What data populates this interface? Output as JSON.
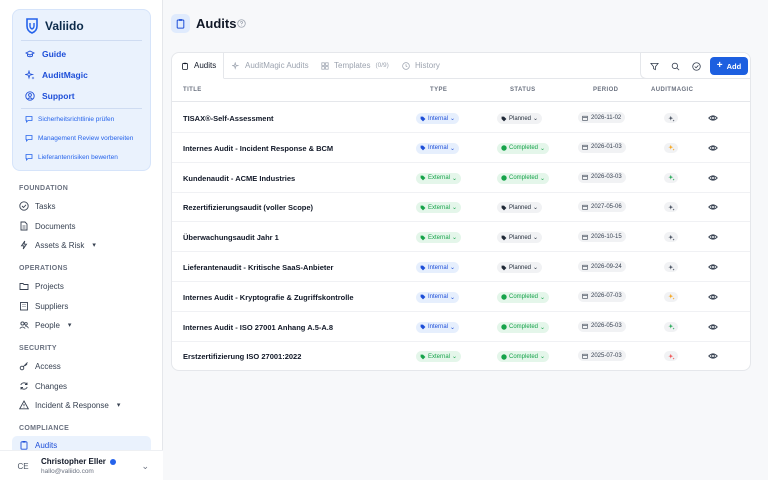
{
  "brand": {
    "name": "Valiido"
  },
  "brand_nav": [
    {
      "label": "Guide",
      "icon": "graduation-cap-icon"
    },
    {
      "label": "AuditMagic",
      "icon": "sparkles-icon"
    },
    {
      "label": "Support",
      "icon": "user-circle-icon"
    }
  ],
  "todos": [
    "Sicherheitsrichtlinie prüfen",
    "Management Review vorbereiten",
    "Lieferantenrisiken bewerten"
  ],
  "sections": {
    "foundation": "FOUNDATION",
    "operations": "OPERATIONS",
    "security": "SECURITY",
    "compliance": "COMPLIANCE"
  },
  "nav": {
    "tasks": "Tasks",
    "documents": "Documents",
    "assets": "Assets & Risk",
    "projects": "Projects",
    "suppliers": "Suppliers",
    "people": "People",
    "access": "Access",
    "changes": "Changes",
    "incident": "Incident & Response",
    "audits": "Audits"
  },
  "user": {
    "initials": "CE",
    "name": "Christopher Eller",
    "email": "hallo@valiido.com"
  },
  "header": {
    "title": "Audits"
  },
  "tabs": {
    "audits": "Audits",
    "auditmagic": "AuditMagic Audits",
    "templates": "Templates",
    "templates_count": "(0/9)",
    "history": "History"
  },
  "toolbar": {
    "add_label": "Add"
  },
  "columns": {
    "title": "TITLE",
    "type": "TYPE",
    "status": "STATUS",
    "period": "PERIOD",
    "auditmagic": "AUDITMAGIC"
  },
  "colors": {
    "accent": "#1d5fe0",
    "internal": "#1d4ed8",
    "external": "#16a34a",
    "completed": "#16a34a",
    "magic_neutral": "#374151",
    "magic_orange": "#f59e0b",
    "magic_green": "#16a34a",
    "magic_red": "#ef4444"
  },
  "rows": [
    {
      "title": "TISAX®-Self-Assessment",
      "type": "Internal",
      "status": "Planned",
      "period": "2026-11-02",
      "magic": "neutral"
    },
    {
      "title": "Internes Audit - Incident Response & BCM",
      "type": "Internal",
      "status": "Completed",
      "period": "2026-01-03",
      "magic": "orange"
    },
    {
      "title": "Kundenaudit - ACME Industries",
      "type": "External",
      "status": "Completed",
      "period": "2026-03-03",
      "magic": "green"
    },
    {
      "title": "Rezertifizierungsaudit (voller Scope)",
      "type": "External",
      "status": "Planned",
      "period": "2027-05-06",
      "magic": "neutral"
    },
    {
      "title": "Überwachungsaudit Jahr 1",
      "type": "External",
      "status": "Planned",
      "period": "2026-10-15",
      "magic": "neutral"
    },
    {
      "title": "Lieferantenaudit - Kritische SaaS-Anbieter",
      "type": "Internal",
      "status": "Planned",
      "period": "2026-09-24",
      "magic": "neutral"
    },
    {
      "title": "Internes Audit - Kryptografie & Zugriffskontrolle",
      "type": "Internal",
      "status": "Completed",
      "period": "2026-07-03",
      "magic": "orange"
    },
    {
      "title": "Internes Audit - ISO 27001 Anhang A.5-A.8",
      "type": "Internal",
      "status": "Completed",
      "period": "2026-05-03",
      "magic": "green"
    },
    {
      "title": "Erstzertifizierung ISO 27001:2022",
      "type": "External",
      "status": "Completed",
      "period": "2025-07-03",
      "magic": "red"
    }
  ]
}
